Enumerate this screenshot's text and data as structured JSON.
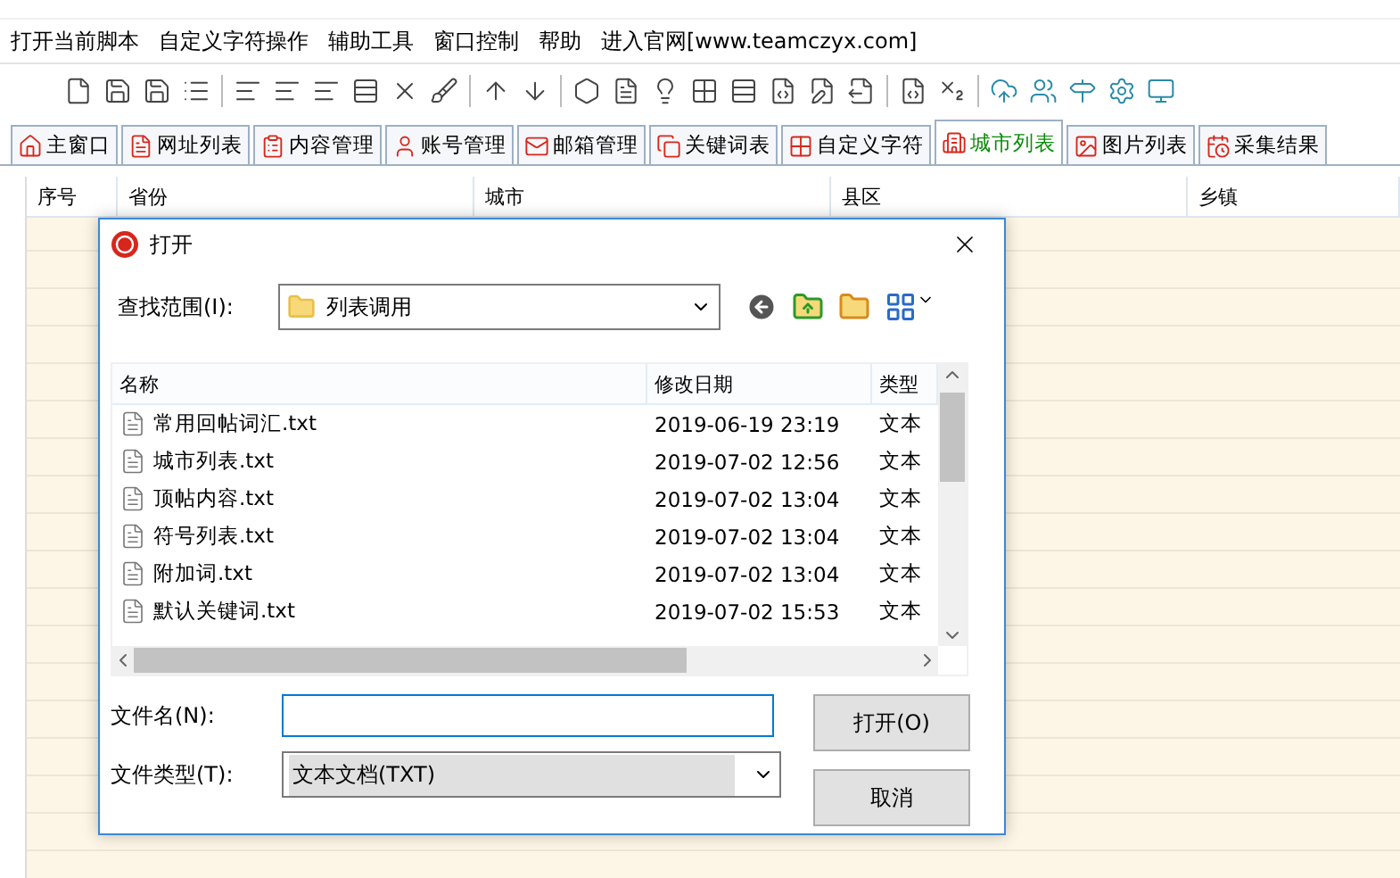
{
  "menu": [
    "打开当前脚本",
    "自定义字符操作",
    "辅助工具",
    "窗口控制",
    "帮助",
    "进入官网[www.teamczyx.com]"
  ],
  "tabs": [
    {
      "label": "主窗口",
      "selected": false
    },
    {
      "label": "网址列表",
      "selected": false
    },
    {
      "label": "内容管理",
      "selected": false
    },
    {
      "label": "账号管理",
      "selected": false
    },
    {
      "label": "邮箱管理",
      "selected": false
    },
    {
      "label": "关键词表",
      "selected": false
    },
    {
      "label": "自定义字符",
      "selected": false
    },
    {
      "label": "城市列表",
      "selected": true
    },
    {
      "label": "图片列表",
      "selected": false
    },
    {
      "label": "采集结果",
      "selected": false
    }
  ],
  "table": {
    "columns": [
      "序号",
      "省份",
      "城市",
      "县区",
      "乡镇"
    ]
  },
  "dialog": {
    "title": "打开",
    "look_in_label": "查找范围(I):",
    "look_in_value": "列表调用",
    "list": {
      "columns": [
        "名称",
        "修改日期",
        "类型"
      ],
      "rows": [
        {
          "name": "常用回帖词汇.txt",
          "date": "2019-06-19 23:19",
          "type": "文本"
        },
        {
          "name": "城市列表.txt",
          "date": "2019-07-02 12:56",
          "type": "文本"
        },
        {
          "name": "顶帖内容.txt",
          "date": "2019-07-02 13:04",
          "type": "文本"
        },
        {
          "name": "符号列表.txt",
          "date": "2019-07-02 13:04",
          "type": "文本"
        },
        {
          "name": "附加词.txt",
          "date": "2019-07-02 13:04",
          "type": "文本"
        },
        {
          "name": "默认关键词.txt",
          "date": "2019-07-02 15:53",
          "type": "文本"
        }
      ]
    },
    "file_name_label": "文件名(N):",
    "file_type_label": "文件类型(T):",
    "file_type_value": "文本文档(TXT)",
    "open_button": "打开(O)",
    "cancel_button": "取消"
  }
}
